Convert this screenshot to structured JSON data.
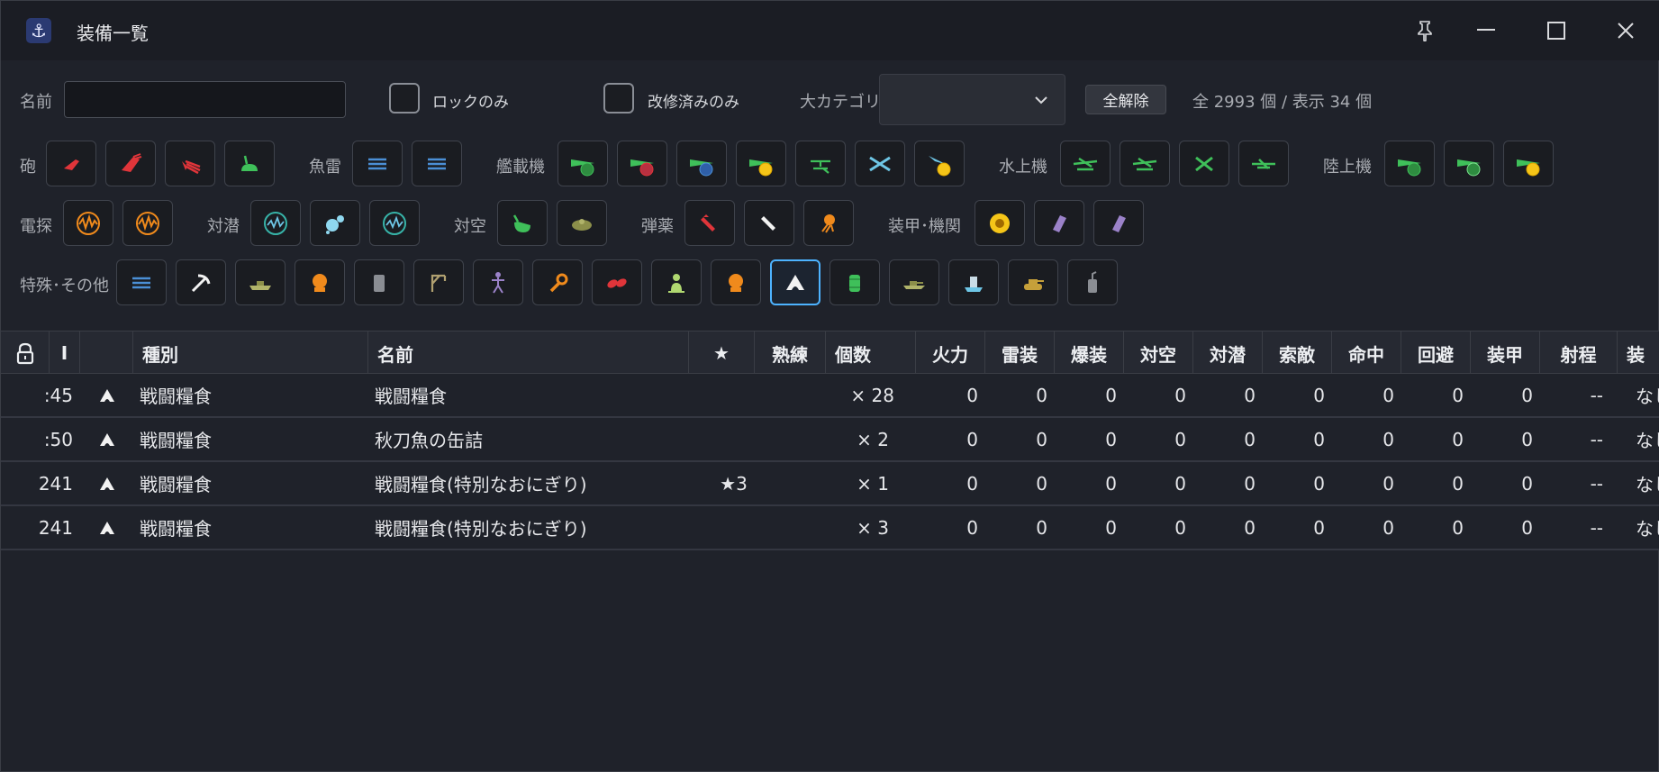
{
  "window": {
    "title": "装備一覧",
    "icon": "anchor-icon",
    "controls": [
      "pin-icon",
      "minimize-icon",
      "maximize-icon",
      "close-icon"
    ]
  },
  "filters": {
    "name_label": "名前",
    "name_value": "",
    "lock_only": {
      "label": "ロックのみ",
      "checked": false
    },
    "improved_only": {
      "label": "改修済みのみ",
      "checked": false
    },
    "category_label": "大カテゴリ",
    "category_value": "",
    "clear_label": "全解除",
    "count_text": "全 2993 個 / 表示 34 個"
  },
  "groups": {
    "gun": "砲",
    "torpedo": "魚雷",
    "carrier": "艦載機",
    "seaplane": "水上機",
    "land": "陸上機",
    "radar": "電探",
    "asw": "対潜",
    "aa": "対空",
    "ammo": "弾薬",
    "armor": "装甲･機関",
    "special": "特殊･その他"
  },
  "table": {
    "headers": {
      "lock": "lock-icon",
      "id": "I",
      "kind": "種別",
      "name": "名前",
      "star": "★",
      "prof": "熟練",
      "count": "個数",
      "fire": "火力",
      "torp": "雷装",
      "bomb": "爆装",
      "aa": "対空",
      "asw": "対潜",
      "los": "索敵",
      "hit": "命中",
      "eva": "回避",
      "armor": "装甲",
      "range": "射程",
      "more": "装"
    },
    "rows": [
      {
        "id": ":45",
        "kind": "戦闘糧食",
        "name": "戦闘糧食",
        "star": "",
        "prof": "",
        "count": "× 28",
        "fire": "0",
        "torp": "0",
        "bomb": "0",
        "aa": "0",
        "asw": "0",
        "los": "0",
        "hit": "0",
        "eva": "0",
        "armor": "0",
        "range": "--",
        "more": "なし"
      },
      {
        "id": ":50",
        "kind": "戦闘糧食",
        "name": "秋刀魚の缶詰",
        "star": "",
        "prof": "",
        "count": "× 2",
        "fire": "0",
        "torp": "0",
        "bomb": "0",
        "aa": "0",
        "asw": "0",
        "los": "0",
        "hit": "0",
        "eva": "0",
        "armor": "0",
        "range": "--",
        "more": "なし"
      },
      {
        "id": "241",
        "kind": "戦闘糧食",
        "name": "戦闘糧食(特別なおにぎり)",
        "star": "★3",
        "prof": "",
        "count": "× 1",
        "fire": "0",
        "torp": "0",
        "bomb": "0",
        "aa": "0",
        "asw": "0",
        "los": "0",
        "hit": "0",
        "eva": "0",
        "armor": "0",
        "range": "--",
        "more": "なし"
      },
      {
        "id": "241",
        "kind": "戦闘糧食",
        "name": "戦闘糧食(特別なおにぎり)",
        "star": "",
        "prof": "",
        "count": "× 3",
        "fire": "0",
        "torp": "0",
        "bomb": "0",
        "aa": "0",
        "asw": "0",
        "los": "0",
        "hit": "0",
        "eva": "0",
        "armor": "0",
        "range": "--",
        "more": "なし"
      }
    ]
  },
  "colors": {
    "accent": "#4db3ff",
    "red": "#e0353a",
    "green": "#3fc05a",
    "blue": "#4b8fd6",
    "orange": "#f08a1c",
    "yellow": "#f5c518",
    "purple": "#9b82c9",
    "teal": "#37b3a8"
  }
}
